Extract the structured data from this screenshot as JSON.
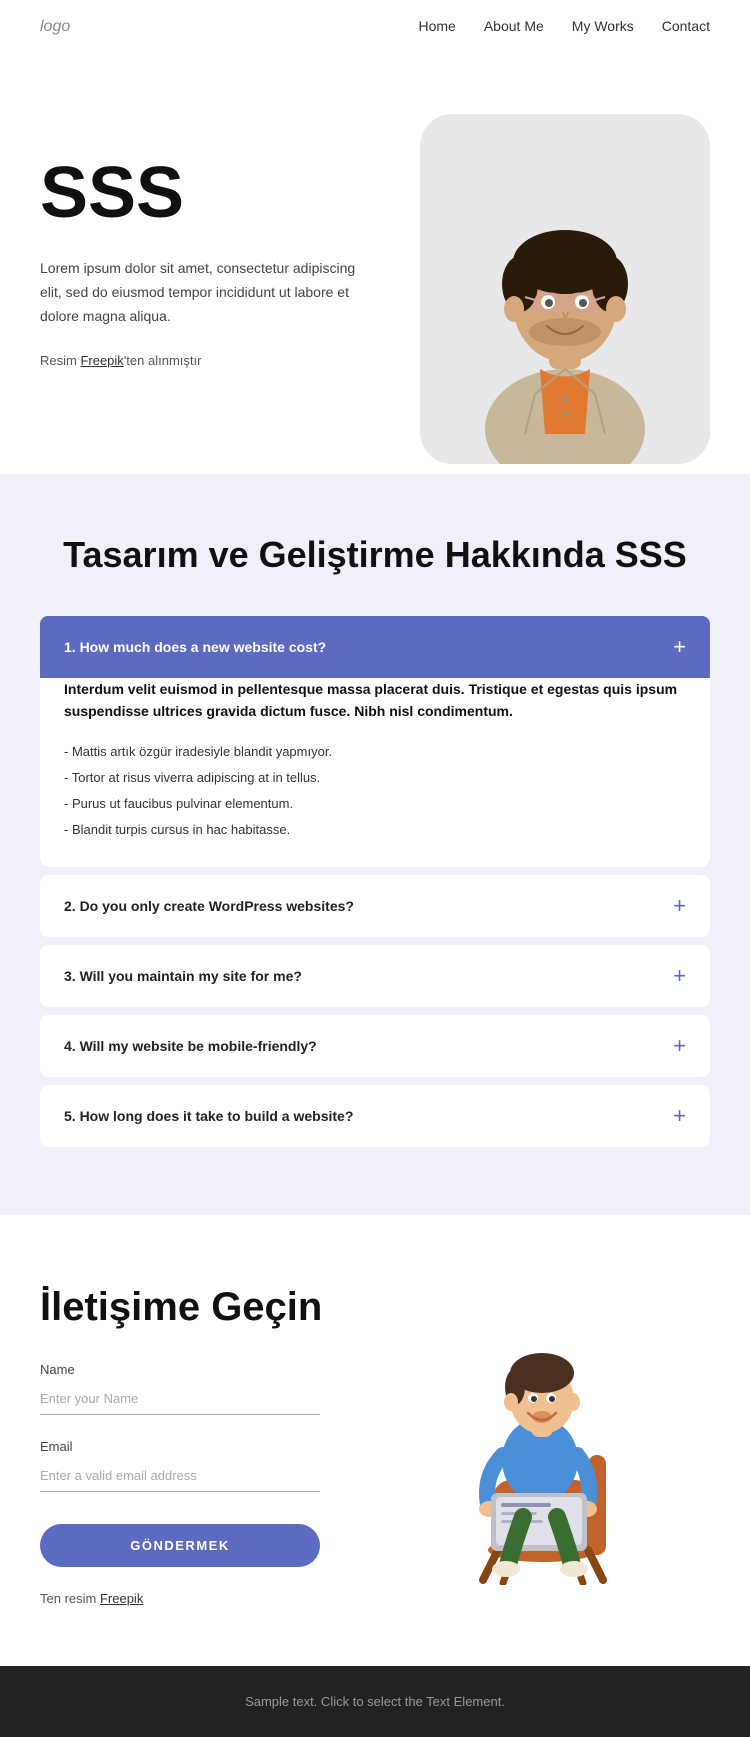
{
  "navbar": {
    "logo": "logo",
    "links": [
      {
        "label": "Home",
        "href": "#"
      },
      {
        "label": "About Me",
        "href": "#"
      },
      {
        "label": "My Works",
        "href": "#"
      },
      {
        "label": "Contact",
        "href": "#"
      }
    ]
  },
  "hero": {
    "title": "SSS",
    "description": "Lorem ipsum dolor sit amet, consectetur adipiscing elit, sed do eiusmod tempor incididunt ut labore et dolore magna aliqua.",
    "credit_prefix": "Resim ",
    "credit_link": "Freepik",
    "credit_suffix": "'ten alınmıştır"
  },
  "faq": {
    "section_title": "Tasarım ve Geliştirme Hakkında SSS",
    "items": [
      {
        "id": 1,
        "question": "1. How much does a new website cost?",
        "active": true,
        "answer_bold": "Interdum velit euismod in pellentesque massa placerat duis. Tristique et egestas quis ipsum suspendisse ultrices gravida dictum fusce. Nibh nisl condimentum.",
        "answer_list": [
          "Mattis artık özgür iradesiyle blandit yapmıyor.",
          "Tortor at risus viverra adipiscing at in tellus.",
          "Purus ut faucibus pulvinar elementum.",
          "Blandit turpis cursus in hac habitasse."
        ]
      },
      {
        "id": 2,
        "question": "2. Do you only create WordPress websites?",
        "active": false
      },
      {
        "id": 3,
        "question": "3. Will you maintain my site for me?",
        "active": false
      },
      {
        "id": 4,
        "question": "4. Will my website be mobile-friendly?",
        "active": false
      },
      {
        "id": 5,
        "question": "5. How long does it take to build a website?",
        "active": false
      }
    ]
  },
  "contact": {
    "title": "İletişime Geçin",
    "name_label": "Name",
    "name_placeholder": "Enter your Name",
    "email_label": "Email",
    "email_placeholder": "Enter a valid email address",
    "submit_label": "GÖNDERMEK",
    "credit_prefix": "Ten resim ",
    "credit_link": "Freepik"
  },
  "footer": {
    "text": "Sample text. Click to select the Text Element."
  }
}
